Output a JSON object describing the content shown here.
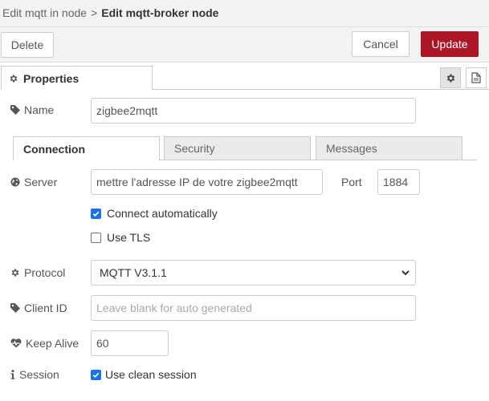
{
  "breadcrumb": {
    "parent": "Edit mqtt in node",
    "separator": ">",
    "current": "Edit mqtt-broker node"
  },
  "toolbar": {
    "delete_label": "Delete",
    "cancel_label": "Cancel",
    "update_label": "Update"
  },
  "tabs": {
    "properties_label": "Properties"
  },
  "form": {
    "name_label": "Name",
    "name_value": "zigbee2mqtt"
  },
  "subtabs": {
    "connection": "Connection",
    "security": "Security",
    "messages": "Messages"
  },
  "connection": {
    "server_label": "Server",
    "server_value": "mettre l'adresse IP de votre zigbee2mqtt",
    "port_label": "Port",
    "port_value": "1884",
    "auto_connect_label": "Connect automatically",
    "auto_connect_checked": true,
    "tls_label": "Use TLS",
    "tls_checked": false,
    "protocol_label": "Protocol",
    "protocol_value": "MQTT V3.1.1",
    "client_id_label": "Client ID",
    "client_id_placeholder": "Leave blank for auto generated",
    "keepalive_label": "Keep Alive",
    "keepalive_value": "60",
    "session_label": "Session",
    "clean_session_label": "Use clean session",
    "clean_session_checked": true
  },
  "colors": {
    "accent": "#ad1625",
    "checkbox": "#1a73e8"
  },
  "icons": {
    "properties": "gear-icon",
    "name": "tag-icon",
    "server": "globe-icon",
    "protocol": "gear-icon",
    "client_id": "tag-icon",
    "keepalive": "heartbeat-icon",
    "session": "info-icon",
    "settings_button": "gear-icon",
    "description_button": "document-icon"
  }
}
